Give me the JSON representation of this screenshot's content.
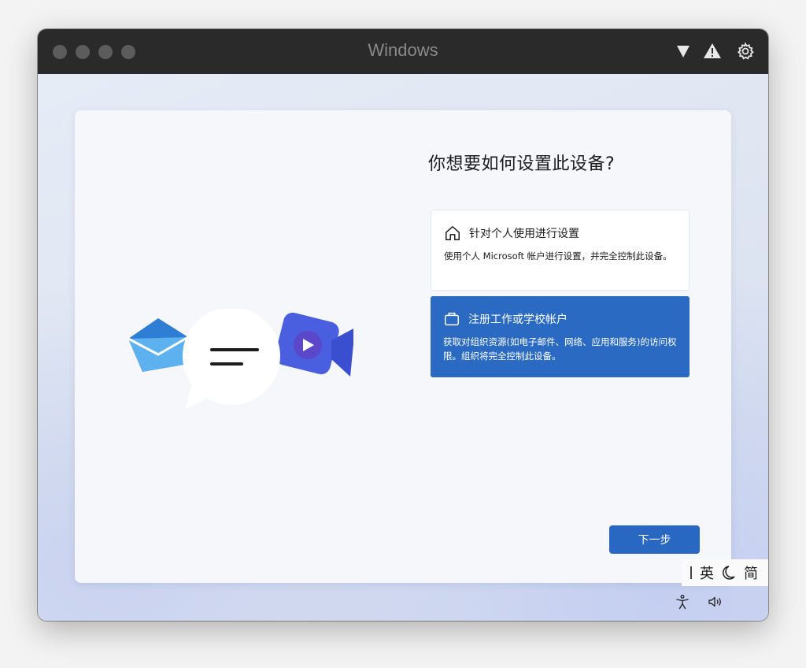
{
  "window": {
    "title": "Windows",
    "titlebar_icons": [
      "down-triangle-icon",
      "warning-icon",
      "gear-icon"
    ]
  },
  "setup": {
    "heading": "你想要如何设置此设备?",
    "options": [
      {
        "icon": "home-icon",
        "title": "针对个人使用进行设置",
        "description": "使用个人 Microsoft 帐户进行设置，并完全控制此设备。",
        "selected": false
      },
      {
        "icon": "briefcase-icon",
        "title": "注册工作或学校帐户",
        "description": "获取对组织资源(如电子邮件、网络、应用和服务)的访问权限。组织将完全控制此设备。",
        "selected": true
      }
    ],
    "next_label": "下一步"
  },
  "ime": {
    "mode": "英",
    "script": "简"
  },
  "system_tray": [
    "accessibility-icon",
    "volume-icon"
  ],
  "colors": {
    "accent": "#2b6ac2",
    "titlebar": "#2b2a2b"
  }
}
